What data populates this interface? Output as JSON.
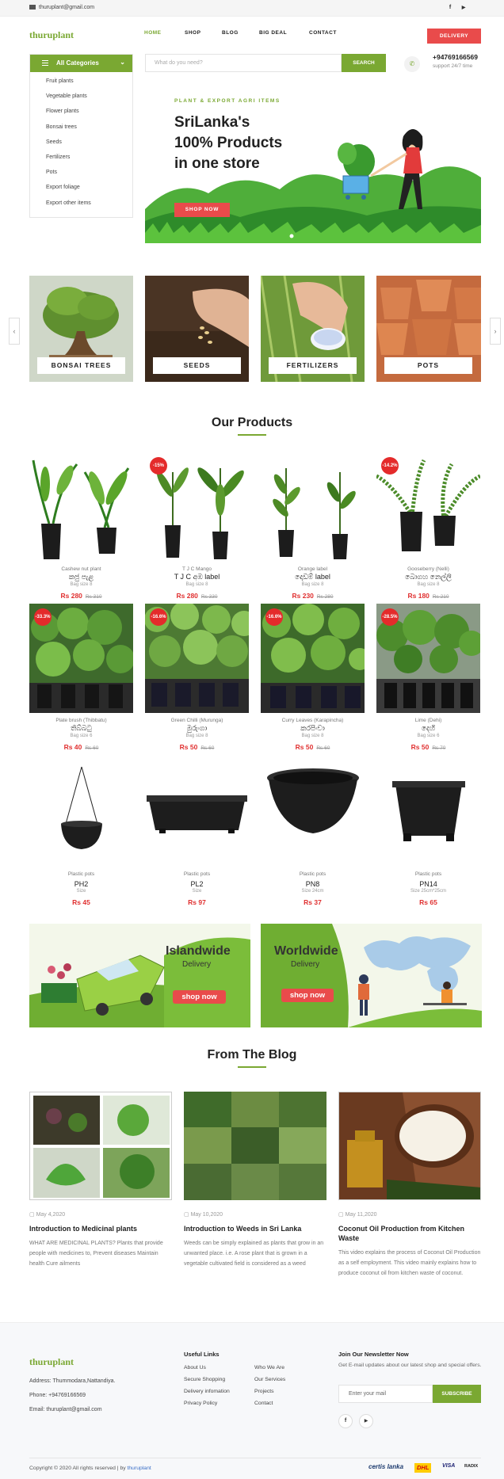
{
  "topbar": {
    "email": "thuruplant@gmail.com",
    "facebook": "f",
    "youtube": "▶"
  },
  "header": {
    "logo": "thuruplant",
    "nav": [
      "HOME",
      "SHOP",
      "BLOG",
      "BIG DEAL",
      "CONTACT"
    ],
    "delivery": "DELIVERY",
    "phone": "+94769166569",
    "support": "support 24/7 time"
  },
  "categories": {
    "title": "All Categories",
    "items": [
      "Fruit plants",
      "Vegetable plants",
      "Flower plants",
      "Bonsai trees",
      "Seeds",
      "Fertilizers",
      "Pots",
      "Export foliage",
      "Export other items"
    ]
  },
  "search": {
    "placeholder": "What do you need?",
    "button": "SEARCH"
  },
  "hero": {
    "tag": "PLANT & EXPORT AGRI ITEMS",
    "line1": "SriLanka's",
    "line2": "100% Products",
    "line3": "in one store",
    "button": "SHOP NOW"
  },
  "category_cards": [
    "BONSAI TREES",
    "SEEDS",
    "FERTILIZERS",
    "POTS"
  ],
  "products_title": "Our Products",
  "products": [
    {
      "sub": "Cashew nut plant",
      "name": "කජු පැළ",
      "bag": "Bag size 8",
      "price": "Rs 280",
      "old": "Rs 310",
      "discount": ""
    },
    {
      "sub": "T J C Mango",
      "name": "T J C අඹ label",
      "bag": "Bag size 8",
      "price": "Rs 280",
      "old": "Rs 330",
      "discount": "-15%"
    },
    {
      "sub": "Orange label",
      "name": "දොඩම් label",
      "bag": "Bag size 8",
      "price": "Rs 230",
      "old": "Rs 280",
      "discount": ""
    },
    {
      "sub": "Gooseberry (Nelli)",
      "name": "බොගහ නෙල්ලි",
      "bag": "Bag size 8",
      "price": "Rs 180",
      "old": "Rs 210",
      "discount": "-14.2%"
    },
    {
      "sub": "Plate brush (Thibbatu)",
      "name": "තිබ්බටු",
      "bag": "Bag size 6",
      "price": "Rs 40",
      "old": "Rs 60",
      "discount": "-33.3%"
    },
    {
      "sub": "Green Chilli (Murunga)",
      "name": "මුරුංගා",
      "bag": "Bag size 8",
      "price": "Rs 50",
      "old": "Rs 60",
      "discount": "-16.6%"
    },
    {
      "sub": "Curry Leaves (Karapincha)",
      "name": "කරපිංචා",
      "bag": "Bag size 8",
      "price": "Rs 50",
      "old": "Rs 60",
      "discount": "-16.6%"
    },
    {
      "sub": "Lime (Dehi)",
      "name": "දෙහි",
      "bag": "Bag size 6",
      "price": "Rs 50",
      "old": "Rs 70",
      "discount": "-28.5%"
    },
    {
      "sub": "Plastic pots",
      "name": "PH2",
      "bag": "Size",
      "price": "Rs 45",
      "old": "",
      "discount": ""
    },
    {
      "sub": "Plastic pots",
      "name": "PL2",
      "bag": "Size",
      "price": "Rs 97",
      "old": "",
      "discount": ""
    },
    {
      "sub": "Plastic pots",
      "name": "PN8",
      "bag": "Size 24cm",
      "price": "Rs 37",
      "old": "",
      "discount": ""
    },
    {
      "sub": "Plastic pots",
      "name": "PN14",
      "bag": "Size 25cm*25cm",
      "price": "Rs 65",
      "old": "",
      "discount": ""
    }
  ],
  "banners": [
    {
      "title": "Islandwide",
      "sub": "Delivery",
      "button": "shop now"
    },
    {
      "title": "Worldwide",
      "sub": "Delivery",
      "button": "shop now"
    }
  ],
  "blog_title": "From The Blog",
  "blog": [
    {
      "date": "May 4,2020",
      "title": "Introduction to Medicinal plants",
      "text": "WHAT ARE MEDICINAL PLANTS? Plants that provide people with medicines to, Prevent diseases Maintain health Cure ailments"
    },
    {
      "date": "May 10,2020",
      "title": "Introduction to Weeds in Sri Lanka",
      "text": "Weeds can be simply explained as plants that grow in an unwanted place. i.e. A rose plant that is grown in a vegetable cultivated field is considered as a weed"
    },
    {
      "date": "May 11,2020",
      "title": "Coconut Oil Production from Kitchen Waste",
      "text": "This video explains the process of Coconut Oil Production as a self employment. This video mainly explains how to produce coconut oil from kitchen waste of coconut."
    }
  ],
  "footer": {
    "logo": "thuruplant",
    "address": "Address: Thummodara,Nattandiya.",
    "phone": "Phone: +94769166569",
    "email": "Email: thuruplant@gmail.com",
    "links_title": "Useful Links",
    "links_col1": [
      "About Us",
      "Secure Shopping",
      "Delivery infomation",
      "Privacy Policy"
    ],
    "links_col2": [
      "Who We Are",
      "Our Services",
      "Projects",
      "Contact"
    ],
    "newsletter_title": "Join Our Newsletter Now",
    "newsletter_text": "Get E-mail updates about our latest shop and special offers.",
    "newsletter_placeholder": "Enter your mail",
    "subscribe": "SUBSCRIBE",
    "copyright": "Copyright © 2020 All rights reserved | by ",
    "copyright_link": "thuruplant",
    "payments": [
      "certis lanka",
      "DHL",
      "VISA",
      "RADIX"
    ]
  }
}
